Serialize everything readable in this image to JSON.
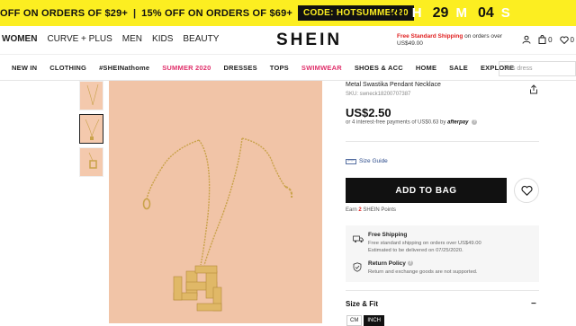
{
  "promo": {
    "offer1": "OFF ON ORDERS OF $29+",
    "separator": "|",
    "offer2": "15% OFF ON ORDERS OF $69+",
    "code": "CODE: HOTSUMMER20",
    "timer": [
      {
        "value": "20",
        "unit": "H"
      },
      {
        "value": "29",
        "unit": "M"
      },
      {
        "value": "04",
        "unit": "S"
      }
    ]
  },
  "header": {
    "categories": [
      {
        "label": "WOMEN",
        "active": true
      },
      {
        "label": "CURVE + PLUS",
        "active": false
      },
      {
        "label": "MEN",
        "active": false
      },
      {
        "label": "KIDS",
        "active": false
      },
      {
        "label": "BEAUTY",
        "active": false
      }
    ],
    "logo": "SHEIN",
    "shipping_highlight": "Free Standard Shipping",
    "shipping_rest": "on orders over US$49.00",
    "bag_count": "0",
    "wishlist_count": "0"
  },
  "subnav": {
    "items": [
      {
        "label": "NEW IN",
        "highlight": false
      },
      {
        "label": "CLOTHING",
        "highlight": false
      },
      {
        "label": "#SHEINathome",
        "highlight": false
      },
      {
        "label": "SUMMER 2020",
        "highlight": true
      },
      {
        "label": "DRESSES",
        "highlight": false
      },
      {
        "label": "TOPS",
        "highlight": false
      },
      {
        "label": "SWIMWEAR",
        "highlight": true
      },
      {
        "label": "SHOES & ACC",
        "highlight": false
      },
      {
        "label": "HOME",
        "highlight": false
      },
      {
        "label": "SALE",
        "highlight": false
      },
      {
        "label": "EXPLORE",
        "highlight": false
      }
    ],
    "search_placeholder": "kids dress"
  },
  "product": {
    "title": "Metal Swastika Pendant Necklace",
    "sku": "SKU: swneck18200707387",
    "price": "US$2.50",
    "installment": "or 4 interest-free payments of US$0.63 by",
    "installment_brand": "afterpay",
    "size_guide": "Size Guide",
    "add_to_bag": "ADD TO BAG",
    "points_prefix": "Earn",
    "points_value": "2",
    "points_suffix": "SHEIN Points",
    "shipping_title": "Free Shipping",
    "shipping_line1": "Free standard shipping on orders over US$49.00",
    "shipping_line2": "Estimated to be delivered on 07/25/2020.",
    "return_title": "Return Policy",
    "return_line1": "Return and exchange goods are not supported.",
    "size_fit": "Size & Fit",
    "collapse_symbol": "−",
    "units": [
      {
        "label": "CM",
        "active": false
      },
      {
        "label": "INCH",
        "active": true
      }
    ]
  },
  "colors": {
    "promo_bg": "#fcee21",
    "accent_red": "#e02020",
    "highlight_pink": "#e0306b",
    "product_bg": "#f1c4a7",
    "button_black": "#111111"
  }
}
